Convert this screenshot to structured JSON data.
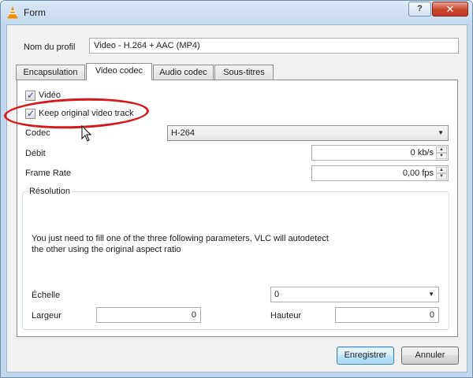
{
  "window": {
    "title": "Form",
    "help_label": "?",
    "close_label": "✕",
    "icon": "vlc-cone-icon"
  },
  "profile": {
    "label": "Nom du profil",
    "value": "Video - H.264 + AAC (MP4)"
  },
  "tabs": [
    {
      "label": "Encapsulation",
      "active": false
    },
    {
      "label": "Video codec",
      "active": true
    },
    {
      "label": "Audio codec",
      "active": false
    },
    {
      "label": "Sous-titres",
      "active": false
    }
  ],
  "video": {
    "video_checkbox_label": "Vidéo",
    "video_checked": true,
    "keep_original_label": "Keep original video track",
    "keep_original_checked": true,
    "codec_label": "Codec",
    "codec_value": "H-264",
    "bitrate_label": "Débit",
    "bitrate_value": "0 kb/s",
    "framerate_label": "Frame Rate",
    "framerate_value": "0,00 fps"
  },
  "resolution": {
    "title": "Résolution",
    "info_line1": "You just need to fill one of the three following parameters, VLC will autodetect",
    "info_line2": "the other using the original aspect ratio",
    "scale_label": "Échelle",
    "scale_value": "0",
    "width_label": "Largeur",
    "width_value": "0",
    "height_label": "Hauteur",
    "height_value": "0"
  },
  "buttons": {
    "save_label": "Enregistrer",
    "cancel_label": "Annuler"
  },
  "colors": {
    "annotation_red": "#d9161c",
    "titlebar": "#c4d9ef",
    "close_button": "#c7452c"
  }
}
